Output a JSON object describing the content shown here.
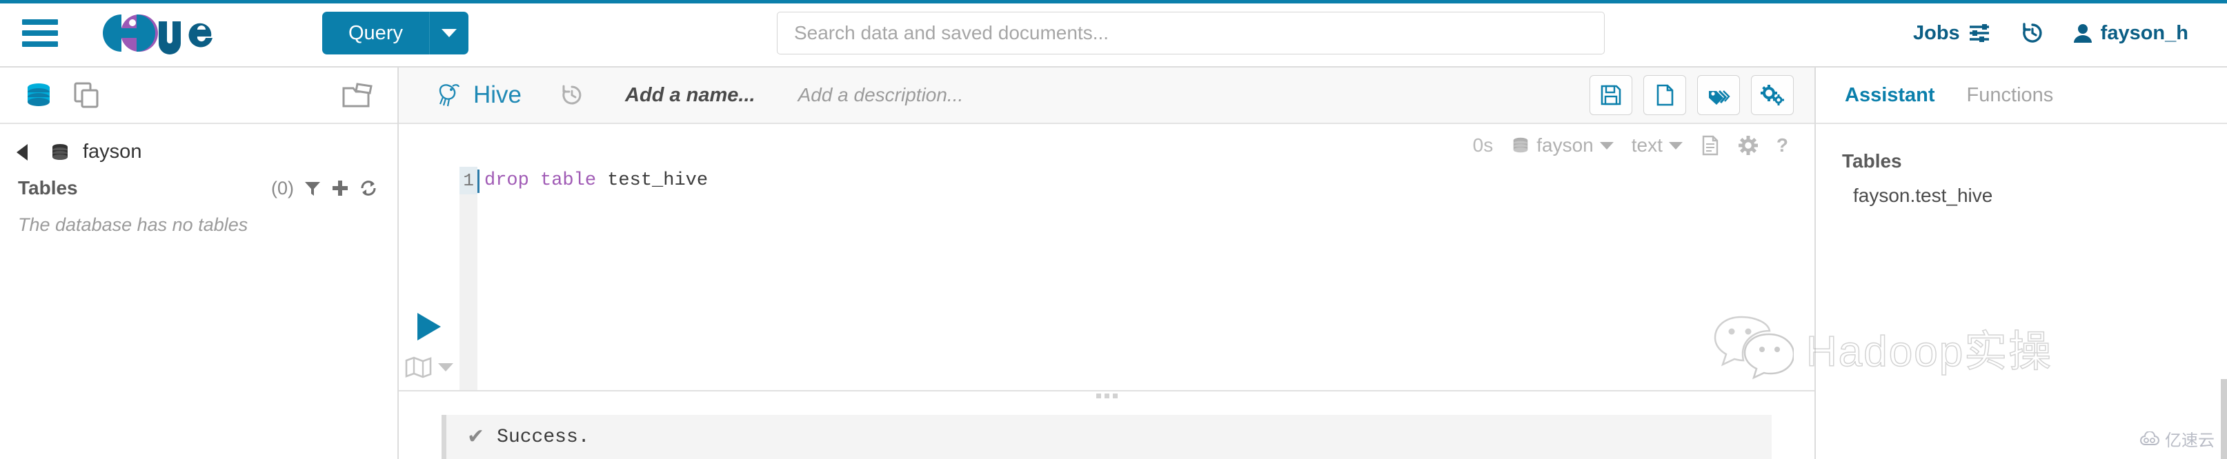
{
  "topbar": {
    "menu_icon": "hamburger-icon",
    "logo_text": "hue",
    "query_button": "Query",
    "query_caret_icon": "chevron-down-icon",
    "search_placeholder": "Search data and saved documents...",
    "search_value": "",
    "jobs_label": "Jobs",
    "jobs_icon": "sliders-icon",
    "history_icon": "history-icon",
    "user_icon": "user-icon",
    "user_name": "fayson_h"
  },
  "sidebar": {
    "tools": [
      {
        "name": "database-icon",
        "label": "Databases",
        "active": true
      },
      {
        "name": "documents-icon",
        "label": "Documents",
        "active": false
      }
    ],
    "folder_icon": "open-folder-icon",
    "back_icon": "chevron-left-icon",
    "breadcrumb_db_icon": "database-icon",
    "breadcrumb_db": "fayson",
    "tables_label": "Tables",
    "tables_count": "(0)",
    "header_icons": [
      {
        "name": "filter-icon"
      },
      {
        "name": "plus-icon"
      },
      {
        "name": "refresh-icon"
      }
    ],
    "empty_message": "The database has no tables"
  },
  "editor": {
    "engine_icon": "hive-icon",
    "engine_name": "Hive",
    "history_icon": "history-icon",
    "name_placeholder": "Add a name...",
    "description_placeholder": "Add a description...",
    "actions": [
      {
        "name": "save-button",
        "icon": "floppy-disk-icon"
      },
      {
        "name": "new-document-button",
        "icon": "file-icon"
      },
      {
        "name": "tags-button",
        "icon": "tags-icon"
      },
      {
        "name": "settings-button",
        "icon": "gears-icon"
      }
    ],
    "status": {
      "elapsed": "0s",
      "database_icon": "database-icon",
      "database": "fayson",
      "format": "text",
      "log-icon": "document-icon",
      "settings_icon": "gear-icon",
      "help_icon": "question-mark-icon"
    },
    "run_icon": "play-icon",
    "map_icon": "map-icon",
    "map_caret_icon": "chevron-down-icon",
    "code": {
      "line_number": "1",
      "keyword1": "drop",
      "keyword2": "table",
      "identifier": "test_hive",
      "full": "drop table test_hive"
    }
  },
  "results": {
    "status_icon": "check-icon",
    "message": "Success."
  },
  "assistant": {
    "tabs": [
      {
        "label": "Assistant",
        "active": true
      },
      {
        "label": "Functions",
        "active": false
      }
    ],
    "tables_header": "Tables",
    "tables": [
      "fayson.test_hive"
    ]
  },
  "watermarks": {
    "wechat_icon": "wechat-icon",
    "hadoop_text": "Hadoop实操",
    "yisu_icon": "cloud-icon",
    "yisu_text": "亿速云"
  },
  "colors": {
    "brand": "#0B7FAB",
    "brand_dark": "#0B5E85",
    "keyword": "#a05bb5",
    "muted": "#9b9b9b"
  }
}
